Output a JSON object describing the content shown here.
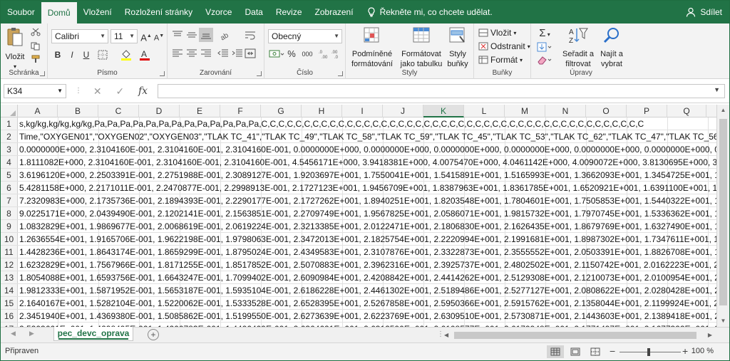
{
  "tabs": [
    "Soubor",
    "Domů",
    "Vložení",
    "Rozložení stránky",
    "Vzorce",
    "Data",
    "Revize",
    "Zobrazení"
  ],
  "tell_me": "Řekněte mi, co chcete udělat.",
  "share": "Sdílet",
  "ribbon": {
    "clipboard": {
      "paste": "Vložit",
      "label": "Schránka"
    },
    "font": {
      "name": "Calibri",
      "size": "11",
      "label": "Písmo",
      "bold": "B",
      "italic": "I",
      "underline": "U"
    },
    "alignment": {
      "label": "Zarovnání"
    },
    "number": {
      "format": "Obecný",
      "label": "Číslo",
      "percent": "%",
      "thousands": "000"
    },
    "styles": {
      "conditional_line1": "Podmíněné",
      "conditional_line2": "formátování",
      "table_line1": "Formátovat",
      "table_line2": "jako tabulku",
      "cell_line1": "Styly",
      "cell_line2": "buňky",
      "label": "Styly"
    },
    "cells": {
      "insert": "Vložit",
      "delete": "Odstranit",
      "format": "Formát",
      "label": "Buňky"
    },
    "editing": {
      "sort_line1": "Seřadit a",
      "sort_line2": "filtrovat",
      "find_line1": "Najít a",
      "find_line2": "vybrat",
      "label": "Úpravy"
    }
  },
  "formula_bar": {
    "name_box": "K34",
    "fx": "fx",
    "value": ""
  },
  "columns": [
    "A",
    "B",
    "C",
    "D",
    "E",
    "F",
    "G",
    "H",
    "I",
    "J",
    "K",
    "L",
    "M",
    "N",
    "O",
    "P",
    "Q"
  ],
  "selected_column": "K",
  "rows": [
    {
      "n": "1",
      "text": "s,kg/kg,kg/kg,kg/kg,Pa,Pa,Pa,Pa,Pa,Pa,Pa,Pa,Pa,Pa,Pa,Pa,Pa,C,C,C,C,C,C,C,C,C,C,C,C,C,C,C,C,C,C,C,C,C,C,C,C,C,C,C,C,C,C,C,C,C,C,C,C,C,C,C,C,C,C,C,C,C"
    },
    {
      "n": "2",
      "text": "Time,\"OXYGEN01\",\"OXYGEN02\",\"OXYGEN03\",\"TLAK TC_41\",\"TLAK TC_49\",\"TLAK TC_58\",\"TLAK TC_59\",\"TLAK TC_45\",\"TLAK TC_53\",\"TLAK TC_62\",\"TLAK TC_47\",\"TLAK TC_56\",\"TLAK TC_64\","
    },
    {
      "n": "3",
      "text": "0.0000000E+000, 2.3104160E-001, 2.3104160E-001, 2.3104160E-001, 0.0000000E+000, 0.0000000E+000, 0.0000000E+000, 0.0000000E+000, 0.0000000E+000, 0.0000000E+000, 0.000000"
    },
    {
      "n": "4",
      "text": "1.8111082E+000, 2.3104160E-001, 2.3104160E-001, 2.3104160E-001, 4.5456171E+000, 3.9418381E+000, 4.0075470E+000, 4.0461142E+000, 4.0090072E+000, 3.8130695E+000, 3.7999071E"
    },
    {
      "n": "5",
      "text": "3.6196120E+000, 2.2503391E-001, 2.2751988E-001, 2.3089127E-001, 1.9203697E+001, 1.7550041E+001, 1.5415891E+001, 1.5165993E+001, 1.3662093E+001, 1.3454725E+001, 1.3930472E"
    },
    {
      "n": "6",
      "text": "5.4281158E+000, 2.2171011E-001, 2.2470877E-001, 2.2998913E-001, 2.1727123E+001, 1.9456709E+001, 1.8387963E+001, 1.8361785E+001, 1.6520921E+001, 1.6391100E+001, 1.6707957E"
    },
    {
      "n": "7",
      "text": "7.2320983E+000, 2.1735736E-001, 2.1894393E-001, 2.2290177E-001, 2.1727262E+001, 1.8940251E+001, 1.8203548E+001, 1.7804601E+001, 1.7505853E+001, 1.5440322E+001, 1.6138633E"
    },
    {
      "n": "8",
      "text": "9.0225171E+000, 2.0439490E-001, 2.1202141E-001, 2.1563851E-001, 2.2709749E+001, 1.9567825E+001, 2.0586071E+001, 1.9815732E+001, 1.7970745E+001, 1.5336362E+001, 1.6604692E"
    },
    {
      "n": "9",
      "text": "1.0832829E+001, 1.9869677E-001, 2.0068619E-001, 2.0619224E-001, 2.3213385E+001, 2.0122471E+001, 2.1806830E+001, 2.1626435E+001, 1.8679769E+001, 1.6327490E+001, 1.7526376E"
    },
    {
      "n": "10",
      "text": "1.2636554E+001, 1.9165706E-001, 1.9622198E-001, 1.9798063E-001, 2.3472013E+001, 2.1825754E+001, 2.2220994E+001, 2.1991681E+001, 1.8987302E+001, 1.7347611E+001, 1.8465931E"
    },
    {
      "n": "11",
      "text": "1.4428236E+001, 1.8643174E-001, 1.8659299E-001, 1.8795024E-001, 2.4349583E+001, 2.3107876E+001, 2.3322873E+001, 2.3555552E+001, 2.0503391E+001, 1.8826708E+001, 1.9405972E"
    },
    {
      "n": "12",
      "text": "1.6232829E+001, 1.7567966E-001, 1.8171255E-001, 1.8517852E-001, 2.5070883E+001, 2.3962316E+001, 2.3925737E+001, 2.4802502E+001, 2.1150742E+001, 2.0162223E+001, 2.0164814E"
    },
    {
      "n": "13",
      "text": "1.8054088E+001, 1.6593756E-001, 1.6643247E-001, 1.7099402E-001, 2.6090984E+001, 2.4208842E+001, 2.4414262E+001, 2.5129308E+001, 2.1210073E+001, 2.0100954E+001, 2.0214169E"
    },
    {
      "n": "14",
      "text": "1.9812333E+001, 1.5871952E-001, 1.5653187E-001, 1.5935104E-001, 2.6186228E+001, 2.4461302E+001, 2.5189486E+001, 2.5277127E+001, 2.0808622E+001, 2.0280428E+001, 2.0749715E"
    },
    {
      "n": "15",
      "text": "2.1640167E+001, 1.5282104E-001, 1.5220062E-001, 1.5333528E-001, 2.6528395E+001, 2.5267858E+001, 2.5950366E+001, 2.5915762E+001, 2.1358044E+001, 2.1199924E+001, 2.1585997E"
    },
    {
      "n": "16",
      "text": "2.3451940E+001, 1.4369380E-001, 1.5085862E-001, 1.5199550E-001, 2.6273639E+001, 2.6223769E+001, 2.6309510E+001, 2.5730871E+001, 2.1443603E+001, 2.1389418E+001, 2.1746906E"
    },
    {
      "n": "17",
      "text": "2.5203661E+001, 1.4298495E-001, 1.4200783E-001, 1.4406409E-001, 2.6364621E+001, 2.6312590E+001, 2.6108577E+001, 2.6179948E+001, 2.1771497E+001, 2.1677322E+001, 2.1952000E"
    }
  ],
  "sheet_tab": "pec_devc_oprava",
  "status": {
    "ready": "Připraven",
    "zoom": "100 %"
  },
  "colors": {
    "accent": "#217346"
  }
}
